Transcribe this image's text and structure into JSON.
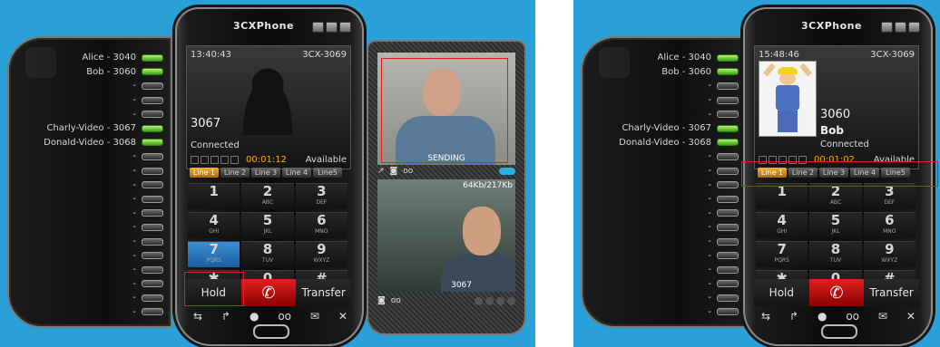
{
  "left": {
    "app_title": "3CXPhone",
    "contacts": [
      {
        "name": "Alice - 3040",
        "on": true
      },
      {
        "name": "Bob - 3060",
        "on": true
      },
      {
        "name": "-",
        "on": false
      },
      {
        "name": "-",
        "on": false
      },
      {
        "name": "-",
        "on": false
      },
      {
        "name": "Charly-Video - 3067",
        "on": true
      },
      {
        "name": "Donald-Video - 3068",
        "on": true
      },
      {
        "name": "-",
        "on": false
      },
      {
        "name": "-",
        "on": false
      },
      {
        "name": "-",
        "on": false
      },
      {
        "name": "-",
        "on": false
      },
      {
        "name": "-",
        "on": false
      },
      {
        "name": "-",
        "on": false
      },
      {
        "name": "-",
        "on": false
      },
      {
        "name": "-",
        "on": false
      },
      {
        "name": "-",
        "on": false
      },
      {
        "name": "-",
        "on": false
      },
      {
        "name": "-",
        "on": false
      },
      {
        "name": "-",
        "on": false
      }
    ],
    "time": "13:40:43",
    "extension": "3CX-3069",
    "caller_number": "3067",
    "state": "Connected",
    "timer": "00:01:12",
    "availability": "Available",
    "lines": [
      "Line 1",
      "Line 2",
      "Line 3",
      "Line 4",
      "Line5"
    ],
    "keys": [
      {
        "d": "1",
        "l": ""
      },
      {
        "d": "2",
        "l": "ABC"
      },
      {
        "d": "3",
        "l": "DEF"
      },
      {
        "d": "4",
        "l": "GHI"
      },
      {
        "d": "5",
        "l": "JKL"
      },
      {
        "d": "6",
        "l": "MNO"
      },
      {
        "d": "7",
        "l": "PQRS"
      },
      {
        "d": "8",
        "l": "TUV"
      },
      {
        "d": "9",
        "l": "WXYZ"
      },
      {
        "d": "✱",
        "l": ""
      },
      {
        "d": "0",
        "l": "+"
      },
      {
        "d": "#",
        "l": ""
      }
    ],
    "hold_label": "Hold",
    "transfer_label": "Transfer",
    "video": {
      "sending_label": "SENDING",
      "bitrate": "64Kb/217Kb",
      "remote_ext": "3067"
    }
  },
  "right": {
    "app_title": "3CXPhone",
    "contacts": [
      {
        "name": "Alice - 3040",
        "on": true
      },
      {
        "name": "Bob - 3060",
        "on": true
      },
      {
        "name": "-",
        "on": false
      },
      {
        "name": "-",
        "on": false
      },
      {
        "name": "-",
        "on": false
      },
      {
        "name": "Charly-Video - 3067",
        "on": true
      },
      {
        "name": "Donald-Video - 3068",
        "on": true
      },
      {
        "name": "-",
        "on": false
      },
      {
        "name": "-",
        "on": false
      },
      {
        "name": "-",
        "on": false
      },
      {
        "name": "-",
        "on": false
      },
      {
        "name": "-",
        "on": false
      },
      {
        "name": "-",
        "on": false
      },
      {
        "name": "-",
        "on": false
      },
      {
        "name": "-",
        "on": false
      },
      {
        "name": "-",
        "on": false
      },
      {
        "name": "-",
        "on": false
      },
      {
        "name": "-",
        "on": false
      },
      {
        "name": "-",
        "on": false
      }
    ],
    "time": "15:48:46",
    "extension": "3CX-3069",
    "caller_number": "3060",
    "caller_name": "Bob",
    "state": "Connected",
    "timer": "00:01:02",
    "availability": "Available",
    "lines": [
      "Line 1",
      "Line 2",
      "Line 3",
      "Line 4",
      "Line5"
    ],
    "keys": [
      {
        "d": "1",
        "l": ""
      },
      {
        "d": "2",
        "l": "ABC"
      },
      {
        "d": "3",
        "l": "DEF"
      },
      {
        "d": "4",
        "l": "GHI"
      },
      {
        "d": "5",
        "l": "JKL"
      },
      {
        "d": "6",
        "l": "MNO"
      },
      {
        "d": "7",
        "l": "PQRS"
      },
      {
        "d": "8",
        "l": "TUV"
      },
      {
        "d": "9",
        "l": "WXYZ"
      },
      {
        "d": "✱",
        "l": ""
      },
      {
        "d": "0",
        "l": "+"
      },
      {
        "d": "#",
        "l": ""
      }
    ],
    "hold_label": "Hold",
    "transfer_label": "Transfer"
  },
  "colors": {
    "background": "#2aa0d8",
    "accent_line": "#f0b030",
    "call_button": "#e02020",
    "timer": "#ffaa00",
    "highlight_box": "#e02020"
  },
  "icons": [
    "transfer-icon",
    "forward-icon",
    "contact-icon",
    "voicemail-icon",
    "messages-icon",
    "mute-icon",
    "phone-icon",
    "camera-icon",
    "record-icon",
    "arrow-icon"
  ]
}
